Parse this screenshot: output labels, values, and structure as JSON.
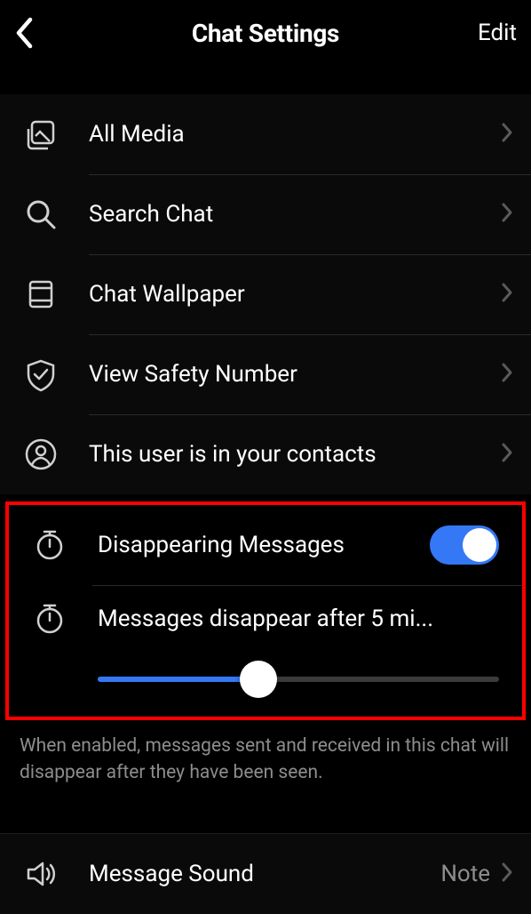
{
  "header": {
    "title": "Chat Settings",
    "edit": "Edit"
  },
  "rows": {
    "allMedia": "All Media",
    "searchChat": "Search Chat",
    "chatWallpaper": "Chat Wallpaper",
    "viewSafety": "View Safety Number",
    "contacts": "This user is in your contacts",
    "disappearing": "Disappearing Messages",
    "disappearAfter": "Messages disappear after 5 mi...",
    "messageSound": "Message Sound",
    "messageSoundValue": "Note"
  },
  "footer": "When enabled, messages sent and received in this chat will disappear after they have been seen.",
  "toggle": {
    "on": true
  },
  "slider": {
    "percent": 40
  }
}
